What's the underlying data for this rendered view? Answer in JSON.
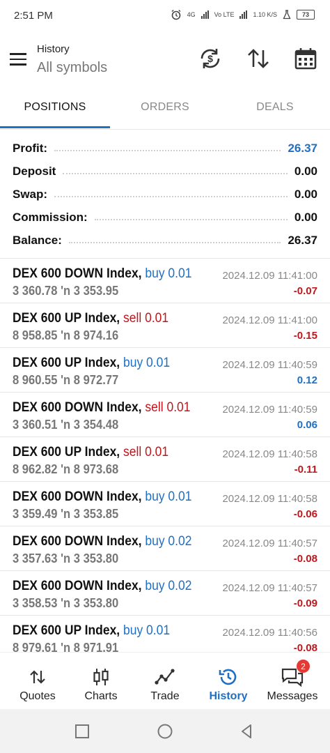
{
  "status_bar": {
    "time": "2:51 PM",
    "net1": "4G",
    "net2": "Vo LTE",
    "speed": "1.10 K/S",
    "battery": "73"
  },
  "header": {
    "title": "History",
    "subtitle": "All symbols",
    "icons": [
      "refresh-currency-icon",
      "sort-icon",
      "calendar-icon"
    ]
  },
  "tabs": [
    {
      "label": "POSITIONS",
      "active": true
    },
    {
      "label": "ORDERS",
      "active": false
    },
    {
      "label": "DEALS",
      "active": false
    }
  ],
  "summary": [
    {
      "label": "Profit:",
      "value": "26.37",
      "color": "#1f6fc4"
    },
    {
      "label": "Deposit",
      "value": "0.00"
    },
    {
      "label": "Swap:",
      "value": "0.00"
    },
    {
      "label": "Commission:",
      "value": "0.00"
    },
    {
      "label": "Balance:",
      "value": "26.37"
    }
  ],
  "trades": [
    {
      "symbol": "DEX 600 DOWN Index,",
      "direction": "buy 0.01",
      "open": "3 360.78",
      "close": "3 353.95",
      "time": "2024.12.09 11:41:00",
      "pl": "-0.07"
    },
    {
      "symbol": "DEX 600 UP Index,",
      "direction": "sell 0.01",
      "open": "8 958.85",
      "close": "8 974.16",
      "time": "2024.12.09 11:41:00",
      "pl": "-0.15"
    },
    {
      "symbol": "DEX 600 UP Index,",
      "direction": "buy 0.01",
      "open": "8 960.55",
      "close": "8 972.77",
      "time": "2024.12.09 11:40:59",
      "pl": "0.12"
    },
    {
      "symbol": "DEX 600 DOWN Index,",
      "direction": "sell 0.01",
      "open": "3 360.51",
      "close": "3 354.48",
      "time": "2024.12.09 11:40:59",
      "pl": "0.06"
    },
    {
      "symbol": "DEX 600 UP Index,",
      "direction": "sell 0.01",
      "open": "8 962.82",
      "close": "8 973.68",
      "time": "2024.12.09 11:40:58",
      "pl": "-0.11"
    },
    {
      "symbol": "DEX 600 DOWN Index,",
      "direction": "buy 0.01",
      "open": "3 359.49",
      "close": "3 353.85",
      "time": "2024.12.09 11:40:58",
      "pl": "-0.06"
    },
    {
      "symbol": "DEX 600 DOWN Index,",
      "direction": "buy 0.02",
      "open": "3 357.63",
      "close": "3 353.80",
      "time": "2024.12.09 11:40:57",
      "pl": "-0.08"
    },
    {
      "symbol": "DEX 600 DOWN Index,",
      "direction": "buy 0.02",
      "open": "3 358.53",
      "close": "3 353.80",
      "time": "2024.12.09 11:40:57",
      "pl": "-0.09"
    },
    {
      "symbol": "DEX 600 UP Index,",
      "direction": "buy 0.01",
      "open": "8 979.61",
      "close": "8 971.91",
      "time": "2024.12.09 11:40:56",
      "pl": "-0.08"
    }
  ],
  "price_separator": "'n",
  "bottom_nav": [
    {
      "label": "Quotes",
      "icon": "quotes-icon",
      "active": false
    },
    {
      "label": "Charts",
      "icon": "charts-icon",
      "active": false
    },
    {
      "label": "Trade",
      "icon": "trade-icon",
      "active": false
    },
    {
      "label": "History",
      "icon": "history-icon",
      "active": true
    },
    {
      "label": "Messages",
      "icon": "messages-icon",
      "active": false,
      "badge": "2"
    }
  ],
  "colors": {
    "accent": "#1f6fc4",
    "loss": "#c0161c",
    "badge": "#e53935"
  }
}
